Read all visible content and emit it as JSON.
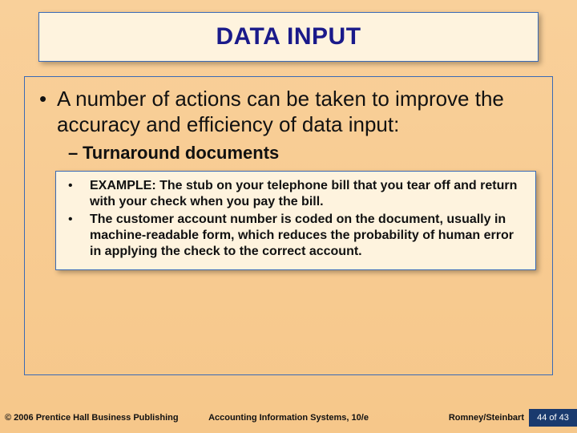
{
  "title": "DATA INPUT",
  "body": {
    "lvl1": "A number of actions can be taken to improve the accuracy and efficiency of data input:",
    "lvl2": "Turnaround documents",
    "lvl3a": "EXAMPLE:  The stub on your telephone bill that you tear off and return with your check when you pay the bill.",
    "lvl3b": "The customer account number is coded on the document, usually in machine-readable form, which reduces the probability of human error in applying the check to the correct account."
  },
  "footer": {
    "copyright": "© 2006 Prentice Hall Business Publishing",
    "booktitle": "Accounting Information Systems, 10/e",
    "authors": "Romney/Steinbart",
    "page": "44 of 43"
  }
}
